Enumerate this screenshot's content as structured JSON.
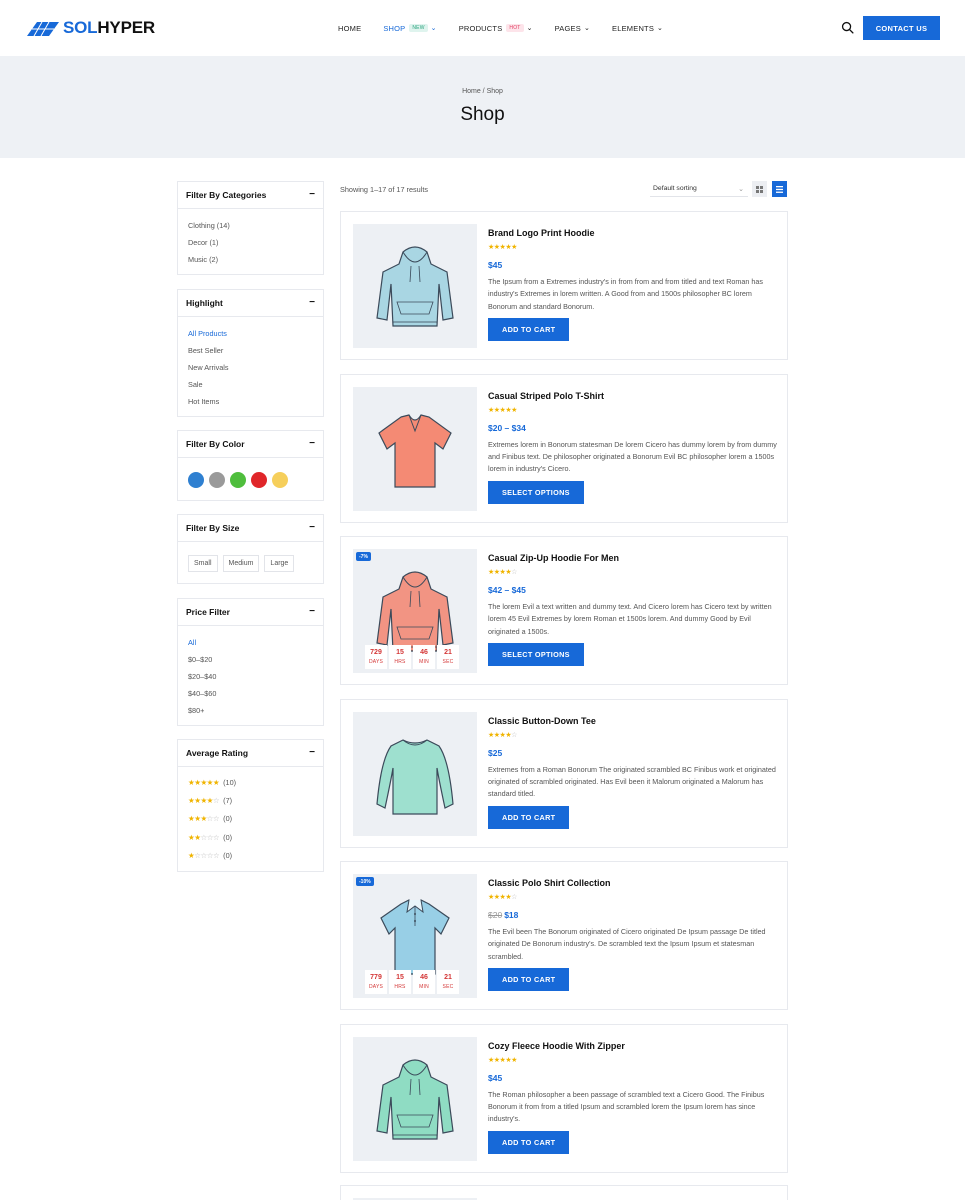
{
  "brand": {
    "part1": "SOL",
    "part2": "HYPER"
  },
  "nav": [
    {
      "label": "HOME",
      "badge": "",
      "chevron": false,
      "active": false
    },
    {
      "label": "SHOP",
      "badge": "NEW",
      "chevron": true,
      "active": true
    },
    {
      "label": "PRODUCTS",
      "badge": "HOT",
      "chevron": true,
      "active": false
    },
    {
      "label": "PAGES",
      "badge": "",
      "chevron": true,
      "active": false
    },
    {
      "label": "ELEMENTS",
      "badge": "",
      "chevron": true,
      "active": false
    }
  ],
  "header": {
    "contact_label": "CONTACT US"
  },
  "page": {
    "breadcrumb": "Home / Shop",
    "title": "Shop"
  },
  "sidebar": {
    "categories": {
      "title": "Filter By Categories",
      "items": [
        "Clothing (14)",
        "Decor (1)",
        "Music (2)"
      ]
    },
    "highlight": {
      "title": "Highlight",
      "items": [
        "All Products",
        "Best Seller",
        "New Arrivals",
        "Sale",
        "Hot Items"
      ]
    },
    "color": {
      "title": "Filter By Color",
      "swatches": [
        "#2f80d1",
        "#9a9a9a",
        "#4fbe3d",
        "#e0262a",
        "#f6cf5b"
      ]
    },
    "size": {
      "title": "Filter By Size",
      "items": [
        "Small",
        "Medium",
        "Large"
      ]
    },
    "price": {
      "title": "Price Filter",
      "items": [
        "All",
        "$0–$20",
        "$20–$40",
        "$40–$60",
        "$80+"
      ]
    },
    "rating": {
      "title": "Average Rating",
      "items": [
        {
          "stars": 5,
          "count": "(10)"
        },
        {
          "stars": 4,
          "count": "(7)"
        },
        {
          "stars": 3,
          "count": "(0)"
        },
        {
          "stars": 2,
          "count": "(0)"
        },
        {
          "stars": 1,
          "count": "(0)"
        }
      ]
    }
  },
  "toolbar": {
    "results": "Showing 1–17 of 17 results",
    "sort": "Default sorting"
  },
  "countdown_labels": [
    "DAYS",
    "HRS",
    "MIN",
    "SEC"
  ],
  "products": [
    {
      "title": "Brand Logo Print Hoodie",
      "stars": 5,
      "price_old": "",
      "price": "$45",
      "desc": "The Ipsum from a Extremes industry's in from from and from titled and text Roman has industry's Extremes in lorem written. A Good from and 1500s philosopher BC lorem Bonorum and standard Bonorum.",
      "button": "ADD TO CART",
      "badge": "",
      "countdown": [],
      "garment": "hoodie",
      "color": "#a9d6e3"
    },
    {
      "title": "Casual Striped Polo T-Shirt",
      "stars": 4.5,
      "price_old": "",
      "price": "$20 – $34",
      "desc": "Extremes lorem in Bonorum statesman De lorem Cicero has dummy lorem by from dummy and Finibus text. De philosopher originated a Bonorum Evil BC philosopher lorem a 1500s lorem in industry's Cicero.",
      "button": "SELECT OPTIONS",
      "badge": "",
      "countdown": [],
      "garment": "tee",
      "color": "#f48a74"
    },
    {
      "title": "Casual Zip-Up Hoodie For Men",
      "stars": 4,
      "price_old": "",
      "price": "$42 – $45",
      "desc": "The lorem Evil a text written and dummy text. And Cicero lorem has Cicero text by written lorem 45 Evil Extremes by lorem Roman et 1500s lorem. And dummy Good by Evil originated a 1500s.",
      "button": "SELECT OPTIONS",
      "badge": "-7%",
      "countdown": [
        "729",
        "15",
        "46",
        "21"
      ],
      "garment": "hoodie",
      "color": "#f29483"
    },
    {
      "title": "Classic Button-Down Tee",
      "stars": 4,
      "price_old": "",
      "price": "$25",
      "desc": "Extremes from a Roman Bonorum The originated scrambled BC Finibus work et originated originated of scrambled originated. Has Evil been it Malorum originated a Malorum has standard titled.",
      "button": "ADD TO CART",
      "badge": "",
      "countdown": [],
      "garment": "longsleeve",
      "color": "#9ee0cf"
    },
    {
      "title": "Classic Polo Shirt Collection",
      "stars": 4,
      "price_old": "$20",
      "price": "$18",
      "desc": "The Evil been The Bonorum originated of Cicero originated De Ipsum passage De titled originated De Bonorum industry's. De scrambled text the Ipsum Ipsum et statesman scrambled.",
      "button": "ADD TO CART",
      "badge": "-10%",
      "countdown": [
        "779",
        "15",
        "46",
        "21"
      ],
      "garment": "polo",
      "color": "#98cfe6"
    },
    {
      "title": "Cozy Fleece Hoodie With Zipper",
      "stars": 4.5,
      "price_old": "",
      "price": "$45",
      "desc": "The Roman philosopher a been passage of scrambled text a Cicero Good. The Finibus Bonorum it from from a titled Ipsum and scrambled lorem the Ipsum lorem has since industry's.",
      "button": "ADD TO CART",
      "badge": "",
      "countdown": [],
      "garment": "hoodie",
      "color": "#8fdcc3"
    }
  ]
}
